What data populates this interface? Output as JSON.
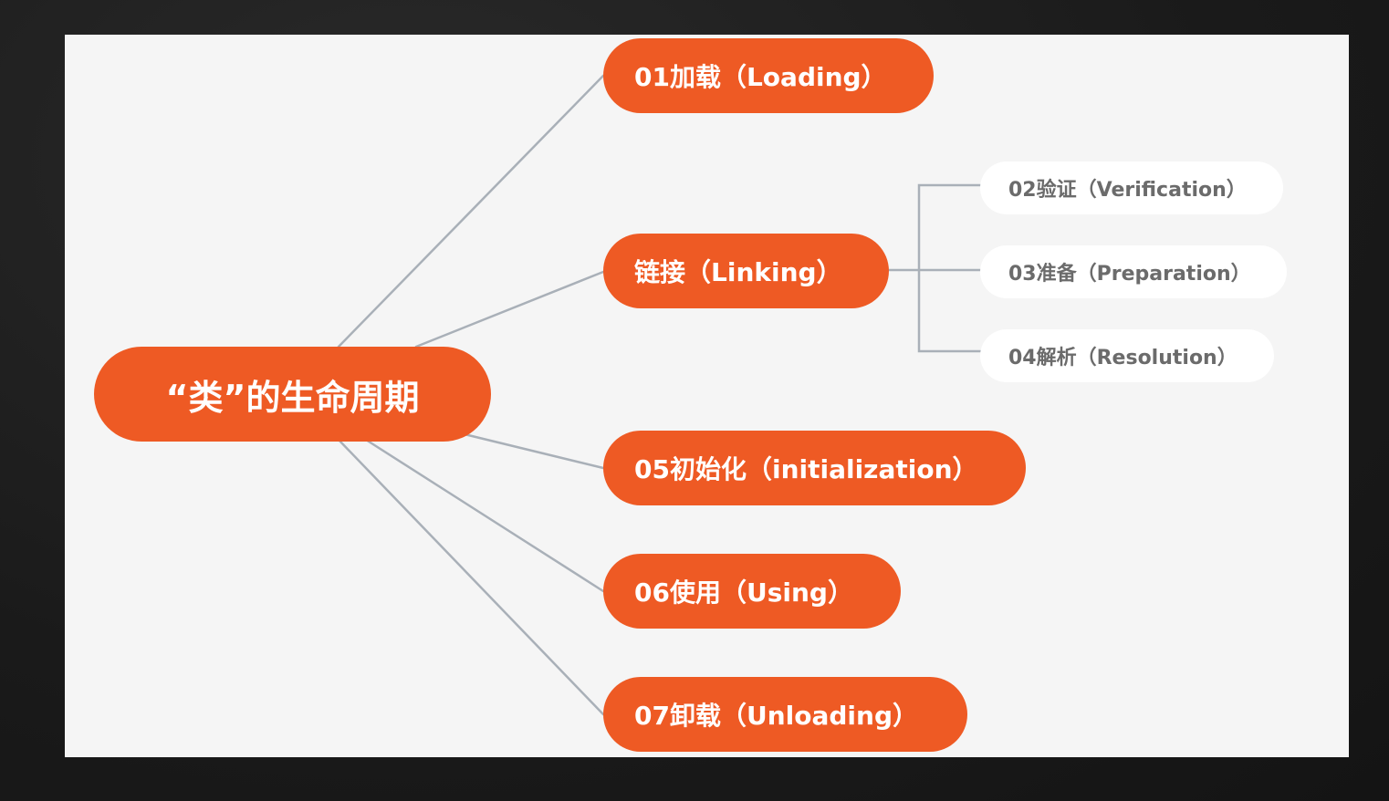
{
  "diagram": {
    "root": {
      "label": "“类”的生命周期"
    },
    "stages": [
      {
        "id": "loading",
        "label": "01加载（Loading）"
      },
      {
        "id": "linking",
        "label": "链接（Linking）"
      },
      {
        "id": "initialization",
        "label": "05初始化（initialization）"
      },
      {
        "id": "using",
        "label": "06使用（Using）"
      },
      {
        "id": "unloading",
        "label": "07卸载（Unloading）"
      }
    ],
    "linking_substages": [
      {
        "id": "verification",
        "label": "02验证（Verification）"
      },
      {
        "id": "preparation",
        "label": "03准备（Preparation）"
      },
      {
        "id": "resolution",
        "label": "04解析（Resolution）"
      }
    ]
  },
  "colors": {
    "accent": "#ee5a24",
    "canvas_background": "#f5f5f5",
    "frame_background": "#1c1c1c",
    "connector": "#a9b0b8",
    "substage_text": "#6b6b6b"
  }
}
